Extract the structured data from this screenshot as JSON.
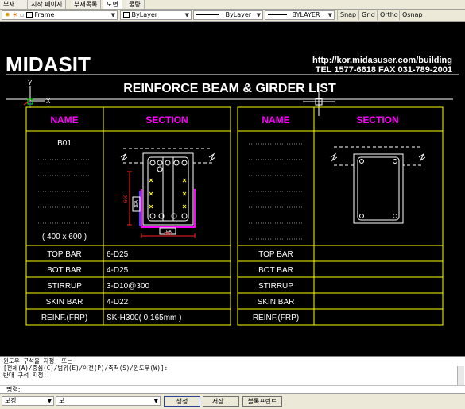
{
  "tabs": [
    "부재",
    "시작 페이지",
    "부재목록",
    "도면",
    "물량"
  ],
  "toolbar": {
    "layer": "Frame",
    "color": "ByLayer",
    "linetype": "ByLayer",
    "lineweight": "BYLAYER",
    "snap": "Snap",
    "grid": "Grid",
    "ortho": "Ortho",
    "osnap": "Osnap"
  },
  "drawing": {
    "logo": "MIDASIT",
    "url": "http://kor.midasuser.com/building",
    "tel": "TEL 1577-6618  FAX 031-789-2001",
    "title": "REINFORCE BEAM & GIRDER LIST",
    "ucs_y": "Y",
    "ucs_x": "X",
    "col_name": "NAME",
    "col_section": "SECTION",
    "beam_name": "B01",
    "beam_size": "( 400 x 600 )",
    "dim_width": "400",
    "dim_height": "600",
    "dim_ea1": "1EA",
    "dim_ea2": "1EA",
    "row_labels": [
      "TOP BAR",
      "BOT BAR",
      "STIRRUP",
      "SKIN BAR",
      "REINF.(FRP)"
    ],
    "row_values": [
      "6-D25",
      "4-D25",
      "3-D10@300",
      "4-D22",
      "SK-H300( 0.165mm )"
    ]
  },
  "command": {
    "lines": [
      "윈도우 구석을 지정, 또는",
      "[전체(A)/중심(C)/범위(E)/이전(P)/축척(S)/윈도우(W)]:",
      "반대 구석 지정:"
    ],
    "prompt_label": "명령:"
  },
  "bottom": {
    "select1": "보강",
    "select2": "보",
    "create": "생성",
    "save": "저장...",
    "plot": "블록프린트"
  },
  "colors": {
    "yellow": "#ffff00",
    "magenta": "#ff00ff",
    "white": "#ffffff",
    "background": "#000000"
  }
}
